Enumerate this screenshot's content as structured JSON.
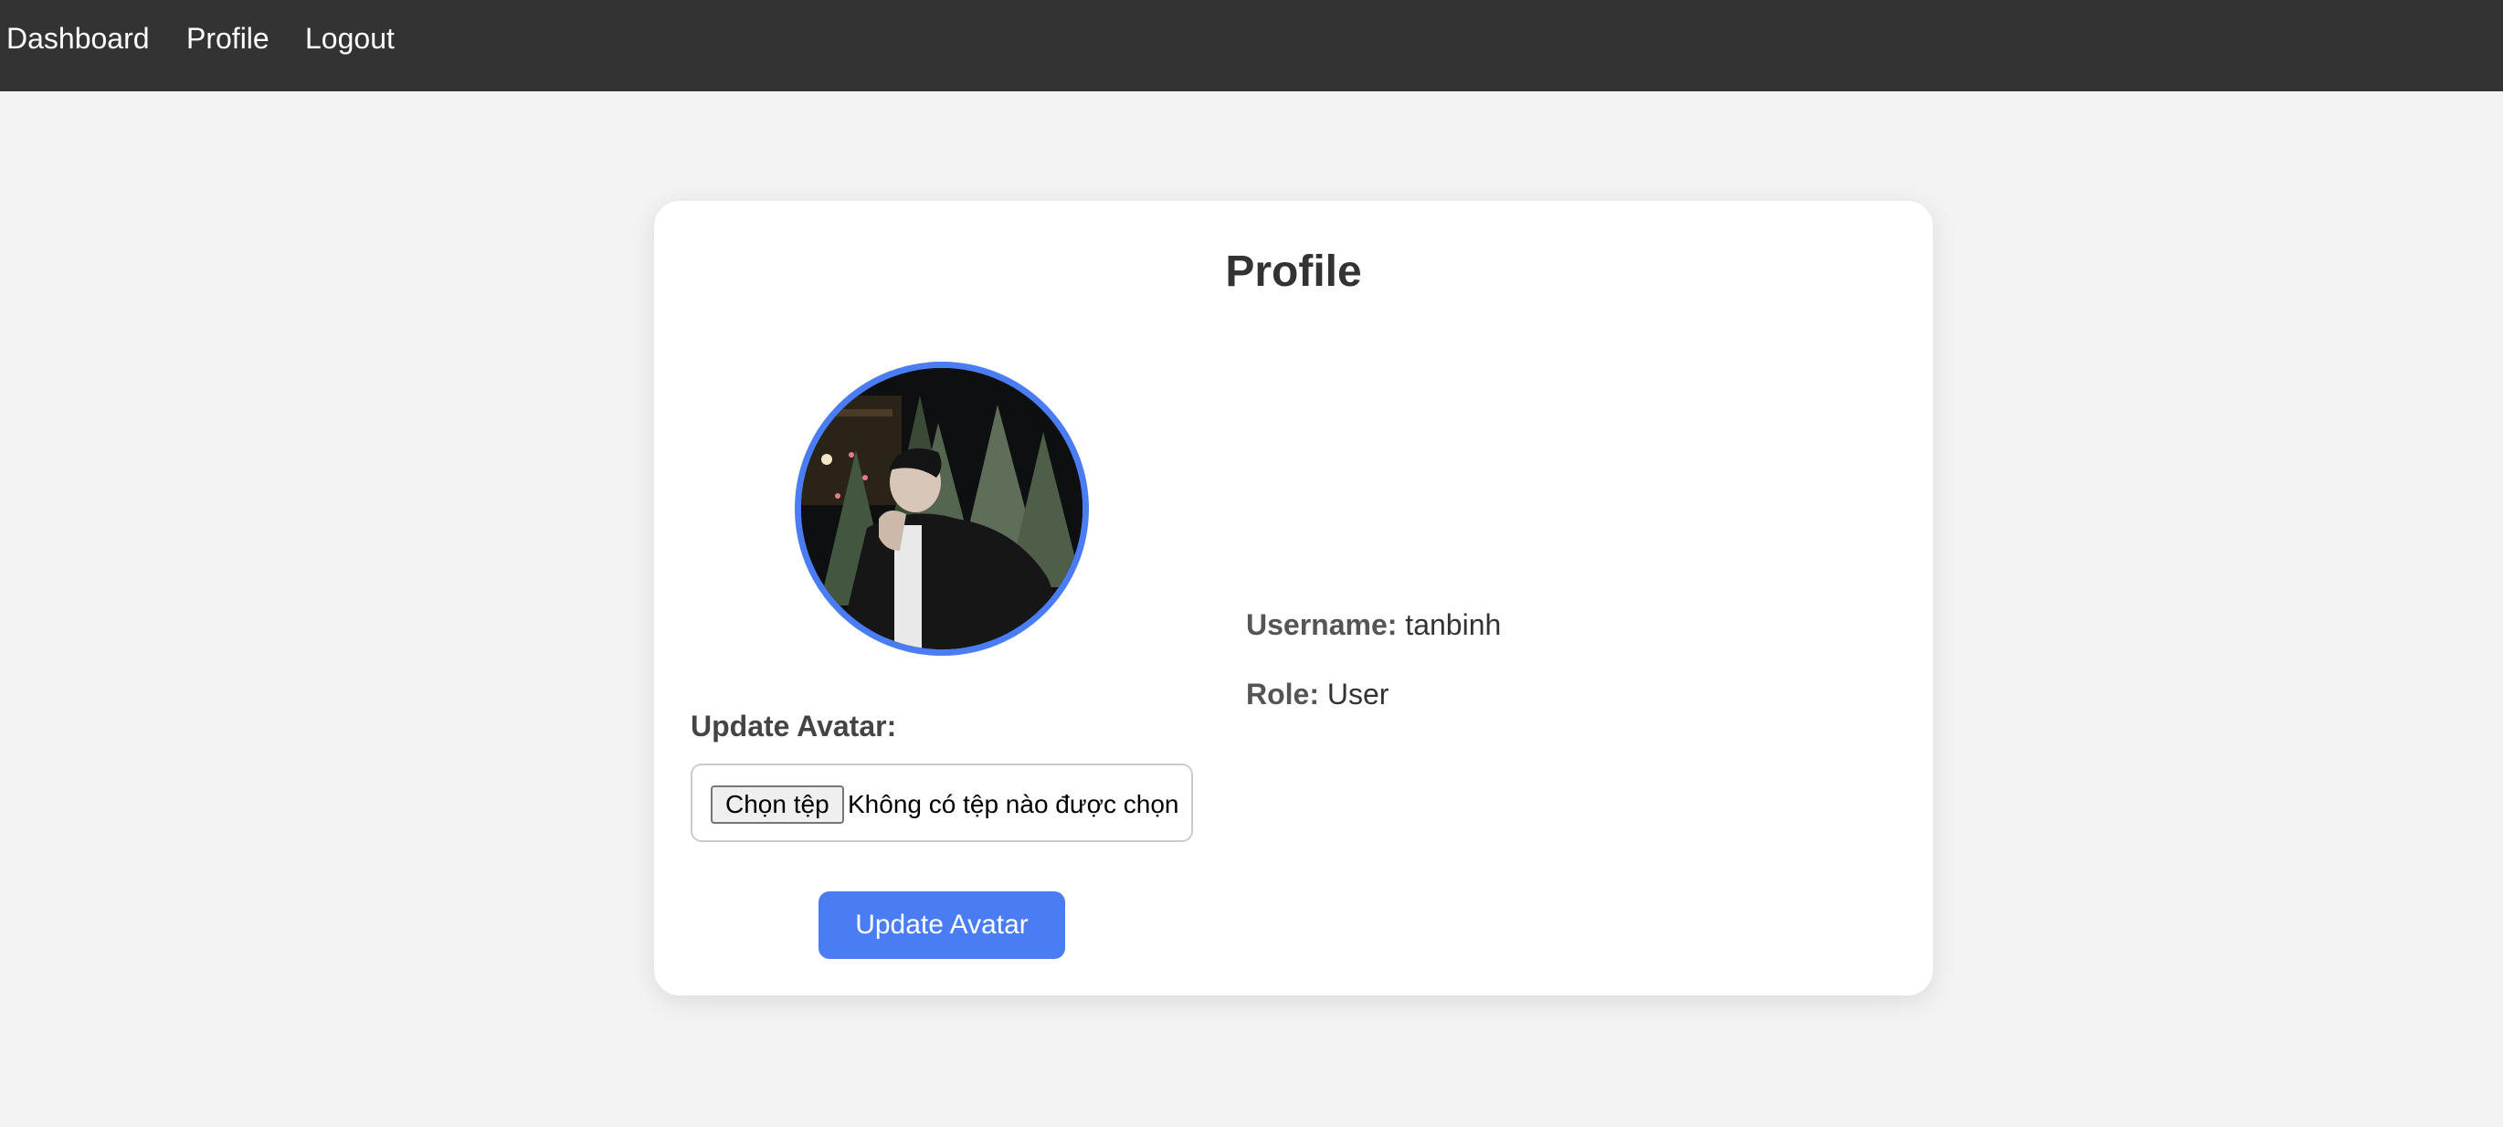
{
  "nav": {
    "items": [
      {
        "label": "Dashboard"
      },
      {
        "label": "Profile"
      },
      {
        "label": "Logout"
      }
    ]
  },
  "profile": {
    "title": "Profile",
    "update_label": "Update Avatar:",
    "file_input": {
      "button_label": "Chọn tệp",
      "status_text": "Không có tệp nào được chọn"
    },
    "submit_label": "Update Avatar",
    "info": {
      "username_key": "Username:",
      "username_value": "tanbinh",
      "role_key": "Role:",
      "role_value": "User"
    }
  },
  "colors": {
    "navbar": "#333333",
    "accent": "#4a7cf3",
    "page_bg": "#f3f3f3",
    "card_bg": "#ffffff"
  }
}
